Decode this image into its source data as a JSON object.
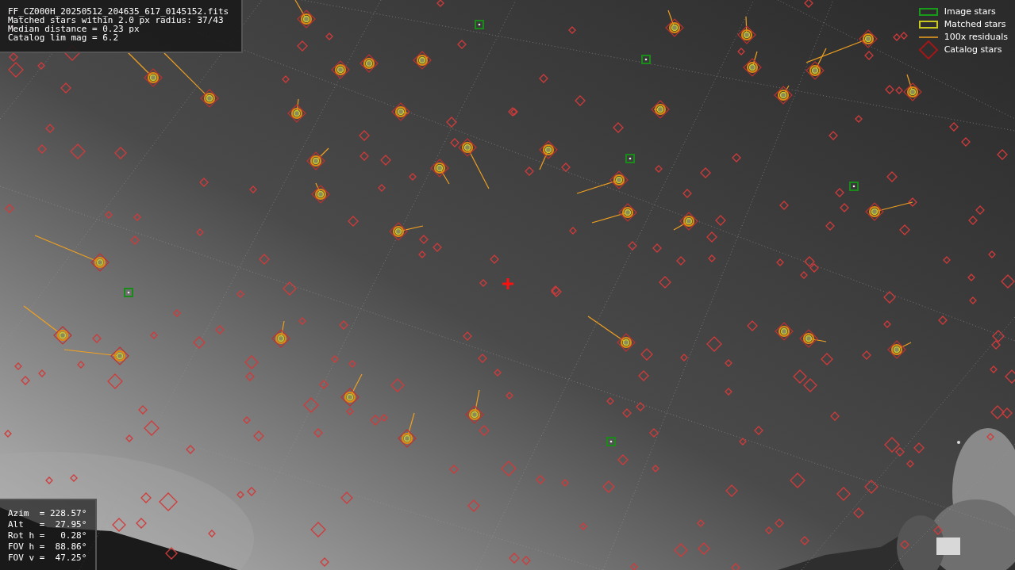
{
  "file_info": {
    "lines": [
      "FF_CZ000H_20250512_204635_617_0145152.fits",
      "Matched stars within 2.0 px radius: 37/43",
      "Median distance = 0.23 px",
      "Catalog lim mag = 6.2"
    ]
  },
  "legend": {
    "items": [
      {
        "label": "Image stars"
      },
      {
        "kind": "matched",
        "label": "Matched stars"
      },
      {
        "kind": "residual",
        "label": "100x residuals"
      },
      {
        "kind": "catalog",
        "label": "Catalog stars"
      }
    ]
  },
  "pointing": {
    "lines": [
      "Azim  = 228.57°",
      "Alt   =  27.95°",
      "Rot h =   0.28°",
      "FOV h =  88.86°",
      "FOV v =  47.25°"
    ]
  }
}
